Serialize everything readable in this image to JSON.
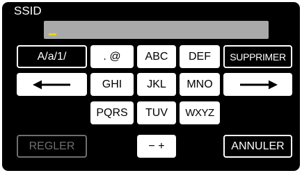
{
  "title": "SSID",
  "input": {
    "value": ""
  },
  "keys": {
    "mode": "A/a/1/",
    "punct": ". @",
    "abc": "ABC",
    "def": "DEF",
    "delete": "SUPPRIMER",
    "ghi": "GHI",
    "jkl": "JKL",
    "mno": "MNO",
    "pqrs": "PQRS",
    "tuv": "TUV",
    "wxyz": "WXYZ",
    "set": "REGLER",
    "minus_plus": "− +",
    "cancel": "ANNULER"
  },
  "icons": {
    "cursor_left": "arrow-left-icon",
    "cursor_right": "arrow-right-icon"
  },
  "colors": {
    "background": "#000000",
    "key": "#ffffff",
    "input": "#a9a9a9",
    "cursor": "#e6d800",
    "disabled": "#6f6f6f"
  }
}
